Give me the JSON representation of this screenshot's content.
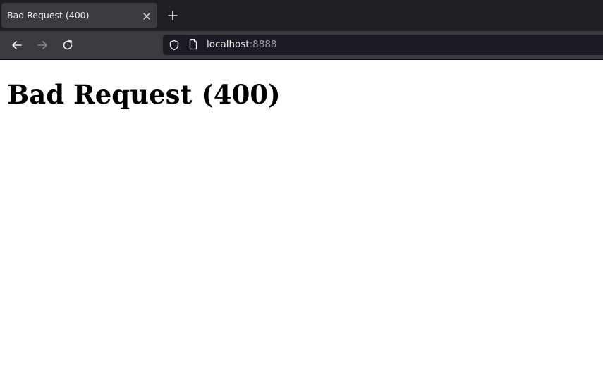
{
  "tab": {
    "title": "Bad Request (400)"
  },
  "urlbar": {
    "host": "localhost",
    "port": ":8888"
  },
  "page": {
    "heading": "Bad Request (400)"
  },
  "icons": {
    "tab_close": "close-icon",
    "new_tab": "plus-icon",
    "back": "arrow-left-icon",
    "forward": "arrow-right-icon",
    "reload": "reload-icon",
    "security": "shield-icon",
    "page": "page-icon"
  },
  "colors": {
    "tabbar_bg": "#1f1e22",
    "toolbar_bg": "#3b3b3f",
    "urlbar_bg": "#1c1b22",
    "text_light": "#f0f0f0",
    "text_dim": "#9a9a9e"
  }
}
